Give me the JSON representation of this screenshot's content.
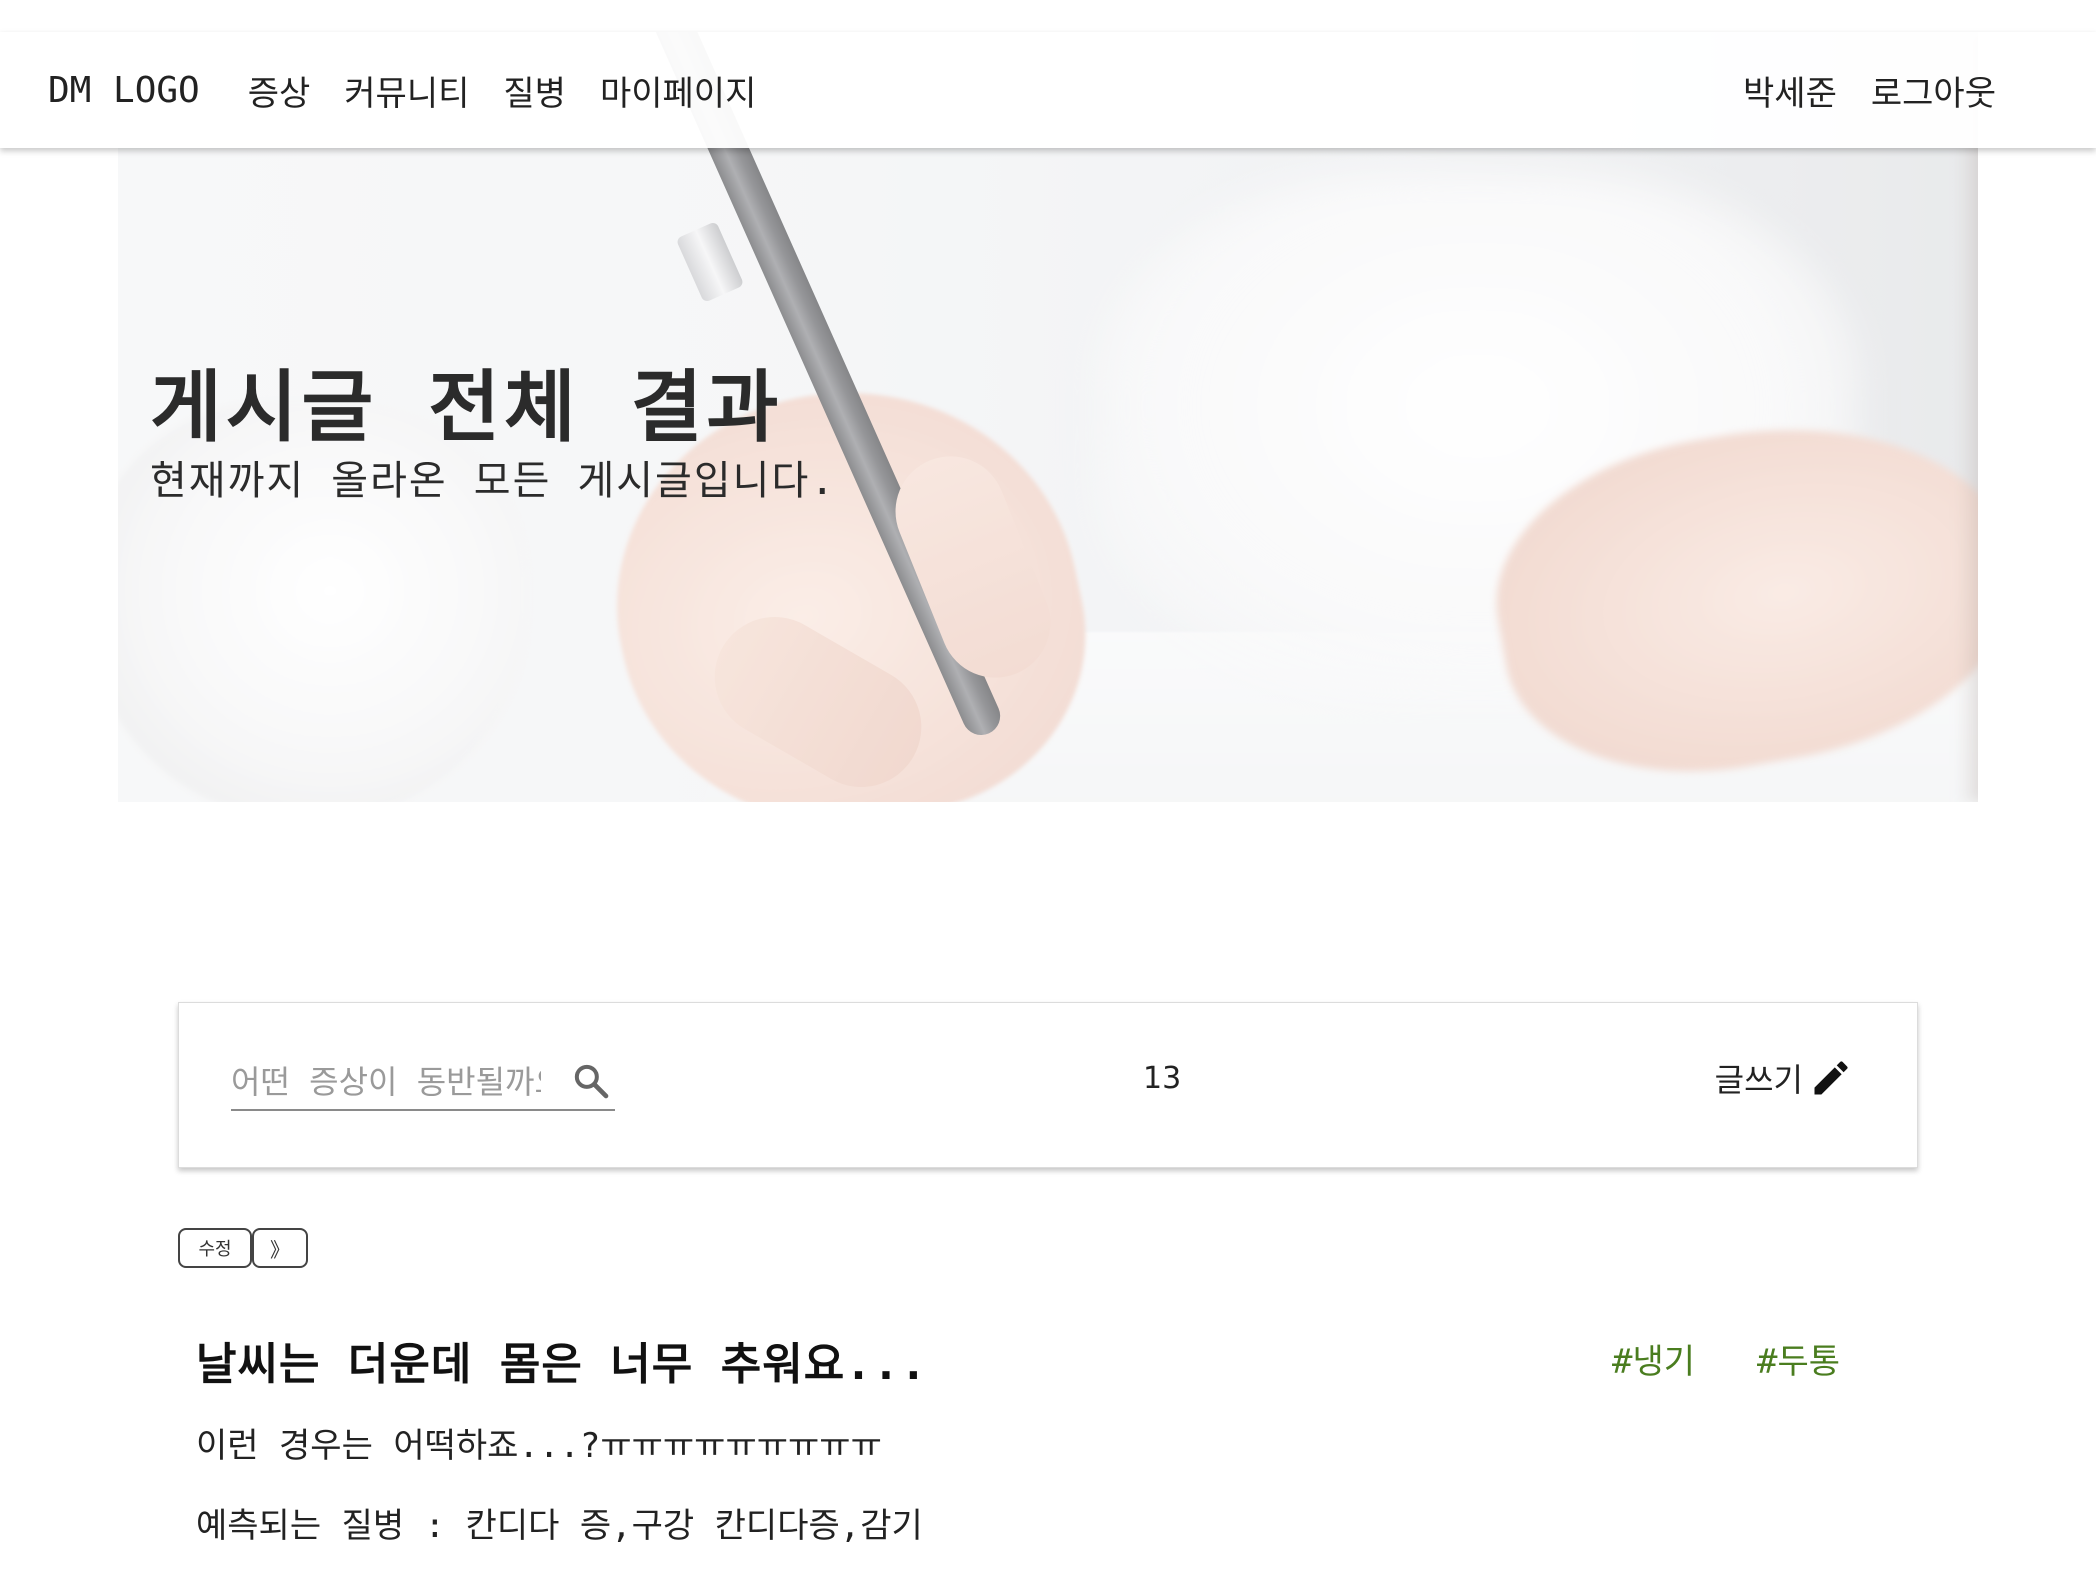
{
  "nav": {
    "logo": "DM LOGO",
    "links": [
      "증상",
      "커뮤니티",
      "질병",
      "마이페이지"
    ],
    "user_name": "박세준",
    "logout": "로그아웃"
  },
  "hero": {
    "title": "게시글 전체 결과",
    "subtitle": "현재까지 올라온 모든 게시글입니다."
  },
  "search": {
    "placeholder": "어떤 증상이 동반될까요?",
    "value": "",
    "icon": "search-icon"
  },
  "post_count": "13",
  "write_button": {
    "label": "글쓰기",
    "icon": "pencil-icon"
  },
  "mini_buttons": {
    "edit": "수정",
    "next": "》"
  },
  "post": {
    "title": "날씨는 더운데 몸은 너무 추워요...",
    "tags": [
      "#냉기",
      "#두통"
    ],
    "body": "이런 경우는 어떡하죠...?ㅠㅠㅠㅠㅠㅠㅠㅠㅠ",
    "predicted_diseases": "예측되는 질병 : 칸디다 증,구강 칸디다증,감기"
  },
  "colors": {
    "tag": "#4a7d1f",
    "navbar_bg": "#ffffff"
  }
}
